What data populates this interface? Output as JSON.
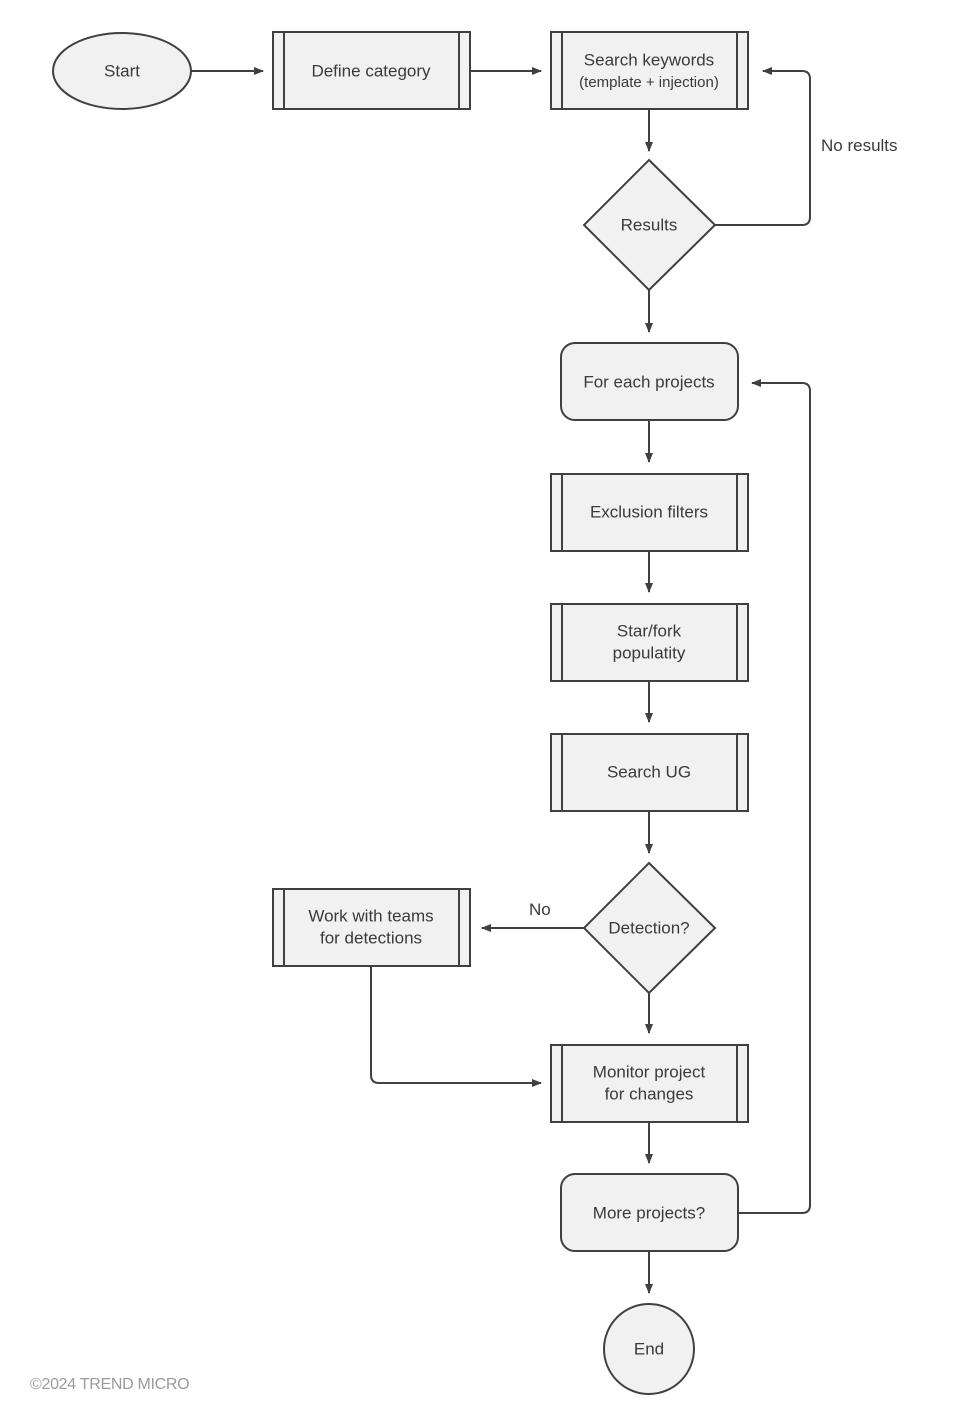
{
  "diagram": {
    "type": "flowchart",
    "colors": {
      "stroke": "#404040",
      "fill": "#f0f1f0",
      "text": "#3a3a3a",
      "footer": "#9a9a9a"
    },
    "nodes": {
      "start": {
        "shape": "ellipse",
        "label": "Start"
      },
      "define_category": {
        "shape": "predefined-process",
        "label": "Define category"
      },
      "search_keywords": {
        "shape": "predefined-process",
        "label": "Search keywords",
        "sublabel": "(template + injection)"
      },
      "results": {
        "shape": "decision",
        "label": "Results"
      },
      "for_each_projects": {
        "shape": "rounded-rect",
        "label": "For each projects"
      },
      "exclusion_filters": {
        "shape": "predefined-process",
        "label": "Exclusion filters"
      },
      "star_fork": {
        "shape": "predefined-process",
        "line1": "Star/fork",
        "line2": "populatity"
      },
      "search_ug": {
        "shape": "predefined-process",
        "label": "Search UG"
      },
      "detection": {
        "shape": "decision",
        "label": "Detection?"
      },
      "work_with_teams": {
        "shape": "predefined-process",
        "line1": "Work with teams",
        "line2": "for detections"
      },
      "monitor_project": {
        "shape": "predefined-process",
        "line1": "Monitor project",
        "line2": "for changes"
      },
      "more_projects": {
        "shape": "rounded-rect",
        "label": "More projects?"
      },
      "end": {
        "shape": "ellipse",
        "label": "End"
      }
    },
    "edges": [
      {
        "from": "start",
        "to": "define_category",
        "label": ""
      },
      {
        "from": "define_category",
        "to": "search_keywords",
        "label": ""
      },
      {
        "from": "search_keywords",
        "to": "results",
        "label": ""
      },
      {
        "from": "results",
        "to": "search_keywords",
        "label": "No results"
      },
      {
        "from": "results",
        "to": "for_each_projects",
        "label": ""
      },
      {
        "from": "for_each_projects",
        "to": "exclusion_filters",
        "label": ""
      },
      {
        "from": "exclusion_filters",
        "to": "star_fork",
        "label": ""
      },
      {
        "from": "star_fork",
        "to": "search_ug",
        "label": ""
      },
      {
        "from": "search_ug",
        "to": "detection",
        "label": ""
      },
      {
        "from": "detection",
        "to": "work_with_teams",
        "label": "No"
      },
      {
        "from": "detection",
        "to": "monitor_project",
        "label": ""
      },
      {
        "from": "work_with_teams",
        "to": "monitor_project",
        "label": ""
      },
      {
        "from": "monitor_project",
        "to": "more_projects",
        "label": ""
      },
      {
        "from": "more_projects",
        "to": "for_each_projects",
        "label": ""
      },
      {
        "from": "more_projects",
        "to": "end",
        "label": ""
      }
    ],
    "edge_labels": {
      "no_results": "No results",
      "no": "No"
    }
  },
  "footer": {
    "copyright": "©2024 TREND MICRO"
  }
}
